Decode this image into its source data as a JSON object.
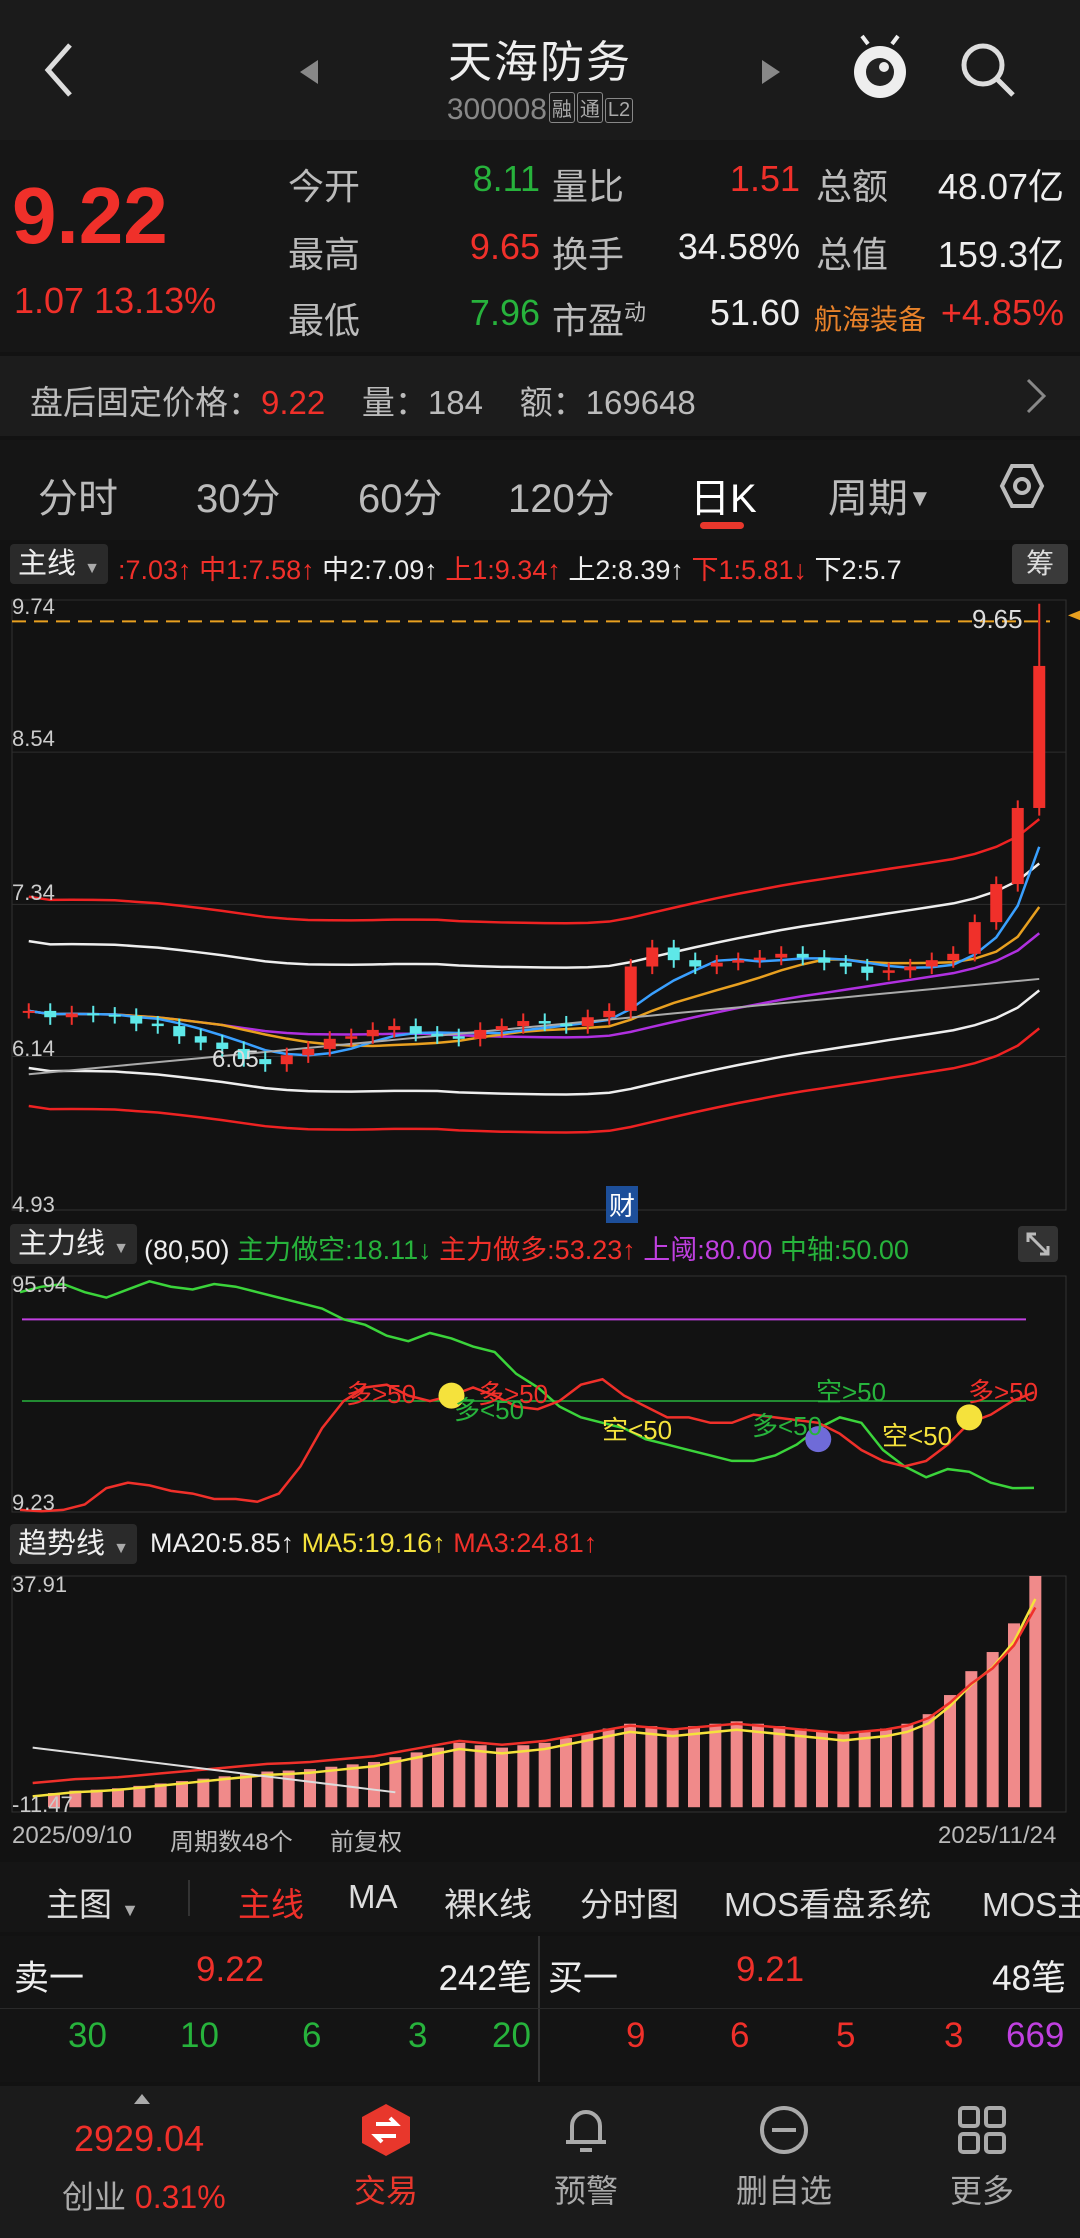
{
  "header": {
    "title": "天海防务",
    "code": "300008",
    "tags": [
      "融",
      "通",
      "L2"
    ]
  },
  "quote": {
    "price": "9.22",
    "change": "1.07",
    "change_pct": "13.13%",
    "rows": [
      {
        "l1": "今开",
        "v1": "8.11",
        "l2": "量比",
        "v2": "1.51",
        "l3": "总额",
        "v3": "48.07亿"
      },
      {
        "l1": "最高",
        "v1": "9.65",
        "l2": "换手",
        "v2": "34.58%",
        "l3": "总值",
        "v3": "159.3亿"
      },
      {
        "l1": "最低",
        "v1": "7.96",
        "l2": "市盈",
        "l2_sup": "动",
        "v2": "51.60",
        "l3": "航海装备",
        "v3": "+4.85%"
      }
    ]
  },
  "after_hours": {
    "label": "盘后固定价格：",
    "price": "9.22",
    "vol_label": "量：",
    "vol": "184",
    "amt_label": "额：",
    "amt": "169648"
  },
  "tabs": [
    "分时",
    "30分",
    "60分",
    "120分",
    "日K",
    "周期"
  ],
  "tab_active": "日K",
  "main_indicator": {
    "button": "主线",
    "items": [
      ":7.03↑",
      "中1:7.58↑",
      "中2:7.09↑",
      "上1:9.34↑",
      "上2:8.39↑",
      "下1:5.81↓",
      "下2:5.7"
    ],
    "chip_button": "筹",
    "axis": [
      "9.74",
      "8.54",
      "7.34",
      "6.14",
      "4.93"
    ],
    "high_label": "9.65",
    "low_label": "6.05",
    "event_tag": "财"
  },
  "force_indicator": {
    "button": "主力线",
    "params": "(80,50)",
    "items": [
      "主力做空:18.11↓",
      "主力做多:53.23↑",
      "上阈:80.00",
      "中轴:50.00"
    ],
    "axis_top": "95.94",
    "axis_bottom": "9.23",
    "marks": [
      "多>50",
      "多<50",
      "多>50",
      "空<50",
      "多<50",
      "空>50",
      "空<50",
      "多>50"
    ]
  },
  "trend_indicator": {
    "button": "趋势线",
    "items": [
      "MA20:5.85↑",
      "MA5:19.16↑",
      "MA3:24.81↑"
    ],
    "axis_top": "37.91",
    "axis_bottom": "-11.47"
  },
  "footer_info": {
    "start_date": "2025/09/10",
    "period_count": "周期数48个",
    "adjust": "前复权",
    "end_date": "2025/11/24"
  },
  "menu": {
    "main_btn": "主图",
    "items": [
      "主线",
      "MA",
      "裸K线",
      "分时图",
      "MOS看盘系统",
      "MOS主"
    ]
  },
  "order_book": {
    "sell_label": "卖一",
    "sell_price": "9.22",
    "sell_count": "242笔",
    "buy_label": "买一",
    "buy_price": "9.21",
    "buy_count": "48笔",
    "sell_queue": [
      "30",
      "10",
      "6",
      "3",
      "20"
    ],
    "buy_queue": [
      "9",
      "6",
      "5",
      "3",
      "669"
    ]
  },
  "nav": {
    "index_value": "2929.04",
    "index_name": "创业",
    "index_pct": "0.31%",
    "items": [
      "交易",
      "预警",
      "删自选",
      "更多"
    ]
  },
  "colors": {
    "up": "#f0302a",
    "down": "#27b33c",
    "bg": "#121212",
    "accent": "#e8372c",
    "purple": "#c040e0"
  },
  "chart_data": [
    {
      "type": "candlestick",
      "title": "日K",
      "ylim": [
        4.93,
        9.74
      ],
      "x_start": "2025/09/10",
      "x_end": "2025/11/24",
      "n": 48,
      "close": [
        6.5,
        6.45,
        6.48,
        6.47,
        6.46,
        6.4,
        6.38,
        6.3,
        6.25,
        6.2,
        6.12,
        6.08,
        6.15,
        6.2,
        6.28,
        6.3,
        6.35,
        6.38,
        6.32,
        6.3,
        6.28,
        6.35,
        6.38,
        6.42,
        6.4,
        6.38,
        6.45,
        6.5,
        6.85,
        7.0,
        6.9,
        6.85,
        6.88,
        6.9,
        6.92,
        6.95,
        6.92,
        6.88,
        6.85,
        6.8,
        6.82,
        6.85,
        6.9,
        6.95,
        7.2,
        7.5,
        8.1,
        9.22
      ],
      "high": 9.65,
      "low": 6.05
    },
    {
      "type": "line",
      "title": "主力线",
      "ylim": [
        9.23,
        95.94
      ],
      "series": [
        {
          "name": "主力做空",
          "values": [
            90,
            92,
            93,
            90,
            88,
            91,
            94,
            92,
            91,
            93,
            92,
            90,
            88,
            86,
            84,
            80,
            78,
            74,
            72,
            75,
            73,
            70,
            68,
            60,
            55,
            48,
            44,
            42,
            40,
            36,
            34,
            32,
            30,
            28,
            28,
            30,
            34,
            40,
            44,
            42,
            32,
            26,
            22,
            25,
            24,
            20,
            18,
            18.11
          ]
        },
        {
          "name": "主力做多",
          "values": [
            10,
            9.5,
            10,
            12,
            18,
            20,
            19,
            17,
            16,
            14,
            14,
            13,
            16,
            26,
            40,
            50,
            55,
            56,
            52,
            50,
            52,
            55,
            52,
            48,
            47,
            50,
            56,
            58,
            52,
            48,
            44,
            44,
            42,
            42,
            45,
            44,
            43,
            42,
            38,
            32,
            28,
            26,
            28,
            34,
            42,
            45,
            50,
            53.23
          ]
        }
      ]
    },
    {
      "type": "bar",
      "title": "趋势线",
      "ylim": [
        -11.47,
        37.91
      ],
      "series": [
        {
          "name": "MA3",
          "values": [
            -8,
            -7.5,
            -7,
            -6.8,
            -6.5,
            -6,
            -5.5,
            -5,
            -4.5,
            -4,
            -3.5,
            -3,
            -2.8,
            -2.5,
            -2,
            -1.5,
            -1,
            0,
            1,
            2,
            3,
            2.5,
            2,
            2.5,
            3,
            4,
            5,
            6,
            7,
            6.5,
            6,
            6.5,
            7,
            7.5,
            7,
            6.5,
            6,
            5.5,
            5,
            5.5,
            6,
            7,
            9,
            13,
            18,
            22,
            28,
            37.91
          ]
        }
      ]
    }
  ]
}
